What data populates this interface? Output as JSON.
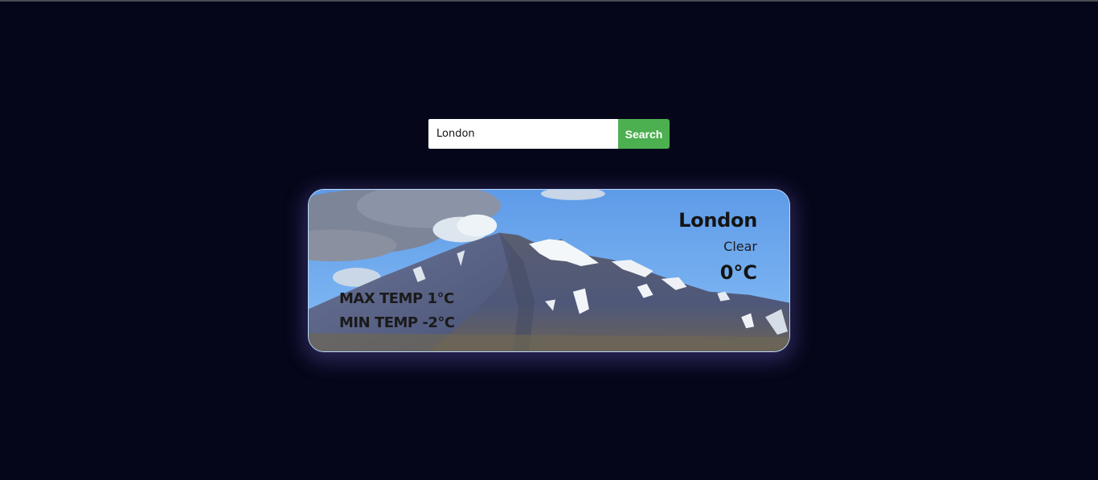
{
  "search": {
    "value": "London",
    "button_label": "Search"
  },
  "weather": {
    "city": "London",
    "condition": "Clear",
    "temperature": "0°C",
    "max_temp_label": "MAX TEMP",
    "max_temp": "1°C",
    "min_temp_label": "MIN TEMP",
    "min_temp": "-2°C"
  },
  "colors": {
    "background": "#06061a",
    "search_button": "#4caf50",
    "text": "#141414"
  }
}
